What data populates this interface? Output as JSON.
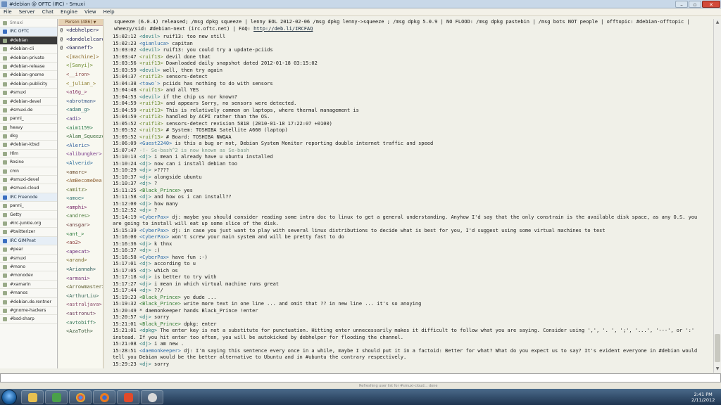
{
  "window": {
    "title": "#debian @ OFTC (IRC) - Smuxi"
  },
  "menu": [
    "File",
    "Server",
    "Chat",
    "Engine",
    "View",
    "Help"
  ],
  "sidebar": [
    {
      "label": "Smuxi",
      "kind": "gone"
    },
    {
      "label": "IRC OFTC",
      "kind": "net"
    },
    {
      "label": "#debian",
      "kind": "active"
    },
    {
      "label": "#debian-cli",
      "kind": ""
    },
    {
      "label": "#debian-private",
      "kind": ""
    },
    {
      "label": "#debian-release",
      "kind": ""
    },
    {
      "label": "#debian-gnome",
      "kind": ""
    },
    {
      "label": "#debian-publicity",
      "kind": ""
    },
    {
      "label": "#smuxi",
      "kind": ""
    },
    {
      "label": "#debian-devel",
      "kind": ""
    },
    {
      "label": "#smuxi.de",
      "kind": ""
    },
    {
      "label": "panni_",
      "kind": ""
    },
    {
      "label": "heavy",
      "kind": ""
    },
    {
      "label": "dkg",
      "kind": ""
    },
    {
      "label": "#debian-kbsd",
      "kind": ""
    },
    {
      "label": "Hlm",
      "kind": ""
    },
    {
      "label": "Rosine",
      "kind": ""
    },
    {
      "label": "cmn",
      "kind": ""
    },
    {
      "label": "#smuxi-devel",
      "kind": ""
    },
    {
      "label": "#smuxi-cloud",
      "kind": ""
    },
    {
      "label": "IRC Freenode",
      "kind": "net"
    },
    {
      "label": "panni_",
      "kind": ""
    },
    {
      "label": "Getty",
      "kind": ""
    },
    {
      "label": "#irc-junkie.org",
      "kind": ""
    },
    {
      "label": "#twitterizer",
      "kind": ""
    },
    {
      "label": "IRC GIMPnet",
      "kind": "net"
    },
    {
      "label": "#pear",
      "kind": ""
    },
    {
      "label": "#smuxi",
      "kind": ""
    },
    {
      "label": "#mono",
      "kind": ""
    },
    {
      "label": "#monodev",
      "kind": ""
    },
    {
      "label": "#xamarin",
      "kind": ""
    },
    {
      "label": "#manos",
      "kind": ""
    },
    {
      "label": "#debian.de.rentner",
      "kind": ""
    },
    {
      "label": "#gnome-hackers",
      "kind": ""
    },
    {
      "label": "#bsd-sharp",
      "kind": ""
    }
  ],
  "userlist": {
    "header": "Person (486)",
    "users": [
      {
        "mode": "@",
        "nick": "debhelper>",
        "color": "#225"
      },
      {
        "mode": "@",
        "nick": "dondelelcaro",
        "color": "#225"
      },
      {
        "mode": "@",
        "nick": "Ganneff>",
        "color": "#225"
      },
      {
        "mode": "",
        "nick": "[machine]>",
        "color": "#8a6a2a"
      },
      {
        "mode": "",
        "nick": "[Sanyi]>",
        "color": "#6a8a2a"
      },
      {
        "mode": "",
        "nick": "__iron>",
        "color": "#8a4a4a"
      },
      {
        "mode": "",
        "nick": "_julian_>",
        "color": "#8a7a2a"
      },
      {
        "mode": "",
        "nick": "a16g_>",
        "color": "#8a3a6a"
      },
      {
        "mode": "",
        "nick": "abrotman>",
        "color": "#3a5a8a"
      },
      {
        "mode": "",
        "nick": "adam_g>",
        "color": "#2a6a6a"
      },
      {
        "mode": "",
        "nick": "adi>",
        "color": "#5a3a8a"
      },
      {
        "mode": "",
        "nick": "aim1159>",
        "color": "#2a7a4a"
      },
      {
        "mode": "",
        "nick": "Alam_Squeeze",
        "color": "#3a6a3a"
      },
      {
        "mode": "",
        "nick": "Aleric>",
        "color": "#2a5a9a"
      },
      {
        "mode": "",
        "nick": "alibungker>",
        "color": "#7a3a8a"
      },
      {
        "mode": "",
        "nick": "Alverid>",
        "color": "#2a6a9a"
      },
      {
        "mode": "",
        "nick": "amarc>",
        "color": "#6a4a2a"
      },
      {
        "mode": "",
        "nick": "AmBecomeDea",
        "color": "#8a5a2a"
      },
      {
        "mode": "",
        "nick": "amitz>",
        "color": "#5a6a2a"
      },
      {
        "mode": "",
        "nick": "amoe>",
        "color": "#3a7a7a"
      },
      {
        "mode": "",
        "nick": "amphi>",
        "color": "#7a2a6a"
      },
      {
        "mode": "",
        "nick": "andres>",
        "color": "#4a7a3a"
      },
      {
        "mode": "",
        "nick": "ansgar>",
        "color": "#6a3a3a"
      },
      {
        "mode": "",
        "nick": "ant_>",
        "color": "#2a7a3a"
      },
      {
        "mode": "",
        "nick": "ao2>",
        "color": "#8a3a3a"
      },
      {
        "mode": "",
        "nick": "apecat>",
        "color": "#6a2a7a"
      },
      {
        "mode": "",
        "nick": "arand>",
        "color": "#7a6a2a"
      },
      {
        "mode": "",
        "nick": "Ariannah>",
        "color": "#2a5a5a"
      },
      {
        "mode": "",
        "nick": "armani>",
        "color": "#7a3a7a"
      },
      {
        "mode": "",
        "nick": "Arrowmaster>",
        "color": "#5a5a2a"
      },
      {
        "mode": "",
        "nick": "ArthurLiu>",
        "color": "#3a6a5a"
      },
      {
        "mode": "",
        "nick": "astraljava>",
        "color": "#8a4a6a"
      },
      {
        "mode": "",
        "nick": "astronut>",
        "color": "#6a3a5a"
      },
      {
        "mode": "",
        "nick": "avtobiff>",
        "color": "#3a7a5a"
      },
      {
        "mode": "",
        "nick": "AzaToth>",
        "color": "#3a5a3a"
      }
    ]
  },
  "topic": {
    "line1": "squeeze (6.0.4) released; /msg dpkg squeeze | lenny EOL 2012-02-06 /msg dpkg lenny->squeeze ; /msg dpkg 5.0.9 | NO FLOOD: /msg dpkg pastebin | /msg bots NOT people | offtopic: #debian-offtopic |",
    "line2": "wheezy/sid: #debian-next (irc.oftc.net) | FAQ: ",
    "link": "http://deb.li/IRCFAQ"
  },
  "messages": [
    {
      "ts": "15:02:12",
      "nick": "<devil>",
      "cls": "nk",
      "text": " ruif13: too new still"
    },
    {
      "ts": "15:02:23",
      "nick": "<gianluca>",
      "cls": "nkc",
      "text": " capitan"
    },
    {
      "ts": "15:03:02",
      "nick": "<devil>",
      "cls": "nk",
      "text": " ruif13: you could try a update-pciids"
    },
    {
      "ts": "15:03:47",
      "nick": "<ruif13>",
      "cls": "nkr",
      "text": " devil done that"
    },
    {
      "ts": "15:03:56",
      "nick": "<ruif13>",
      "cls": "nkr",
      "text": " Downloaded daily snapshot dated 2012-01-18 03:15:02"
    },
    {
      "ts": "15:03:59",
      "nick": "<devil>",
      "cls": "nk",
      "text": " well, then try again"
    },
    {
      "ts": "15:04:37",
      "nick": "<ruif13>",
      "cls": "nkr",
      "text": " sensors-detect"
    },
    {
      "ts": "15:04:38",
      "nick": "<towo`>",
      "cls": "nkc",
      "text": " pciids has nothing to do with sensors"
    },
    {
      "ts": "15:04:48",
      "nick": "<ruif13>",
      "cls": "nkr",
      "text": " and all YES"
    },
    {
      "ts": "15:04:53",
      "nick": "<devil>",
      "cls": "nk",
      "text": " if the chip us nor known?"
    },
    {
      "ts": "15:04:59",
      "nick": "<ruif13>",
      "cls": "nkr",
      "text": " and appears Sorry, no sensors were detected."
    },
    {
      "ts": "15:04:59",
      "nick": "<ruif13>",
      "cls": "nkr",
      "text": " This is relatively common on laptops, where thermal management is"
    },
    {
      "ts": "15:04:59",
      "nick": "<ruif13>",
      "cls": "nkr",
      "text": " handled by ACPI rather than the OS."
    },
    {
      "ts": "15:05:52",
      "nick": "<ruif13>",
      "cls": "nkr",
      "text": " sensors-detect revision 5818 (2010-01-18 17:22:07 +0100)"
    },
    {
      "ts": "15:05:52",
      "nick": "<ruif13>",
      "cls": "nkr",
      "text": " # System: TOSHIBA Satellite A660 (laptop)"
    },
    {
      "ts": "15:05:52",
      "nick": "<ruif13>",
      "cls": "nkr",
      "text": " # Board: TOSHIBA NWQAA"
    },
    {
      "ts": "15:06:09",
      "nick": "<Guest2240>",
      "cls": "nkg",
      "text": " is this a bug or not, Debian System Monitor reporting double internet traffic and speed"
    },
    {
      "ts": "15:07:47",
      "nick": "",
      "cls": "sys",
      "text": " -!- Se-bash^2 is now known as Se-bash",
      "sys": true
    },
    {
      "ts": "15:10:13",
      "nick": "<dj>",
      "cls": "nkd",
      "text": " i mean i already have u ubuntu installed"
    },
    {
      "ts": "15:10:24",
      "nick": "<dj>",
      "cls": "nkd",
      "text": " now can i install debian too"
    },
    {
      "ts": "15:10:29",
      "nick": "<dj>",
      "cls": "nkd",
      "text": " >????"
    },
    {
      "ts": "15:10:37",
      "nick": "<dj>",
      "cls": "nkd",
      "text": " alongside ubuntu"
    },
    {
      "ts": "15:10:37",
      "nick": "<dj>",
      "cls": "nkd",
      "text": " ?"
    },
    {
      "ts": "15:11:25",
      "nick": "<Black_Prince>",
      "cls": "nkb",
      "text": " yes"
    },
    {
      "ts": "15:11:58",
      "nick": "<dj>",
      "cls": "nkd",
      "text": " and how os i can install??"
    },
    {
      "ts": "15:12:00",
      "nick": "<dj>",
      "cls": "nkd",
      "text": " how many"
    },
    {
      "ts": "15:12:52",
      "nick": "<dj>",
      "cls": "nkd",
      "text": " ?"
    },
    {
      "ts": "15:14:19",
      "nick": "<CyberPax>",
      "cls": "nkg",
      "text": " dj: maybe you should consider reading some intro doc to linux to get a general understanding. Anyhow I'd say that the only constrain is the available disk space, as any O.S. you"
    },
    {
      "ts": "",
      "nick": "",
      "cls": "",
      "text": "are going to install will eat up some slice of the disk.",
      "cont": true
    },
    {
      "ts": "15:15:39",
      "nick": "<CyberPax>",
      "cls": "nkg",
      "text": " dj: in case you just want to play with several linux distributions to decide what is best for you, I'd suggest using some virtual machines to test"
    },
    {
      "ts": "15:16:00",
      "nick": "<CyberPax>",
      "cls": "nkg",
      "text": " won't screw your main system and will be pretty fast to do"
    },
    {
      "ts": "15:16:36",
      "nick": "<dj>",
      "cls": "nkd",
      "text": " k thnx"
    },
    {
      "ts": "15:16:37",
      "nick": "<dj>",
      "cls": "nkd",
      "text": " :)"
    },
    {
      "ts": "15:16:58",
      "nick": "<CyberPax>",
      "cls": "nkg",
      "text": " have fun :-)"
    },
    {
      "ts": "15:17:01",
      "nick": "<dj>",
      "cls": "nkd",
      "text": " according to u"
    },
    {
      "ts": "15:17:05",
      "nick": "<dj>",
      "cls": "nkd",
      "text": " which os"
    },
    {
      "ts": "15:17:18",
      "nick": "<dj>",
      "cls": "nkd",
      "text": " is better to try with"
    },
    {
      "ts": "15:17:27",
      "nick": "<dj>",
      "cls": "nkd",
      "text": " i mean in which virtual machine runs great"
    },
    {
      "ts": "15:17:44",
      "nick": "<dj>",
      "cls": "nkd",
      "text": " ??/"
    },
    {
      "ts": "15:19:23",
      "nick": "<Black_Prince>",
      "cls": "nkb",
      "text": " yo dude ..."
    },
    {
      "ts": "15:19:32",
      "nick": "<Black_Prince>",
      "cls": "nkb",
      "text": " write more text in one line ... and omit that ?? in new line ... it's so anoying"
    },
    {
      "ts": "15:20:49",
      "nick": "",
      "cls": "act",
      "text": "  * daemonkeeper hands Black_Prince !enter"
    },
    {
      "ts": "15:20:57",
      "nick": "<dj>",
      "cls": "nkd",
      "text": " sorry"
    },
    {
      "ts": "15:21:01",
      "nick": "<Black_Prince>",
      "cls": "nkb",
      "text": " dpkg: enter"
    },
    {
      "ts": "15:21:01",
      "nick": "<dpkg>",
      "cls": "nkd",
      "text": " The enter key is not a substitute for punctuation.  Hitting enter unnecessarily makes it difficult to follow what you are saying.  Consider using ',', '. ', ';', '...', '---', or ':'"
    },
    {
      "ts": "",
      "nick": "",
      "cls": "",
      "text": "instead.  If you hit enter too often, you will be autokicked by debhelper for flooding the channel.",
      "cont": true
    },
    {
      "ts": "15:21:08",
      "nick": "<dj>",
      "cls": "nkd",
      "text": " i am new ."
    },
    {
      "ts": "15:28:51",
      "nick": "<daemonkeeper>",
      "cls": "nkg",
      "text": " dj: I'm saying this sentence every once in a while, maybe I should put it in a factoid: Better for what? What do you expect us to say? It's evident everyone in #debian would"
    },
    {
      "ts": "",
      "nick": "",
      "cls": "",
      "text": "tell you Debian would be the better alternative to Ubuntu and in #ubuntu the contrary respectively.",
      "cont": true
    },
    {
      "ts": "15:29:23",
      "nick": "<dj>",
      "cls": "nkd",
      "text": " sorry"
    }
  ],
  "status": {
    "text": "Refreshing user list for #smuxi-cloud... done"
  },
  "clock": {
    "time": "2:41 PM",
    "date": "2/11/2012"
  }
}
